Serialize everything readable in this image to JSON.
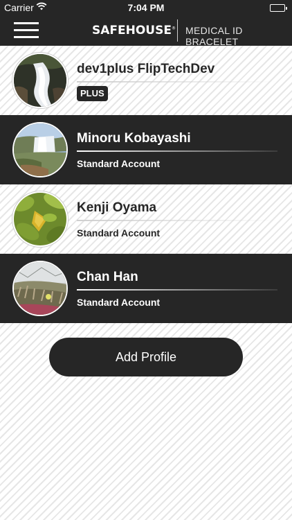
{
  "status_bar": {
    "carrier": "Carrier",
    "time": "7:04 PM"
  },
  "header": {
    "brand": "SAFEHOUSE",
    "brand_mark": "®",
    "subtitle": "MEDICAL ID BRACELET"
  },
  "profiles": [
    {
      "name": "dev1plus FlipTechDev",
      "badge": "PLUS",
      "theme": "light"
    },
    {
      "name": "Minoru Kobayashi",
      "account": "Standard Account",
      "theme": "dark"
    },
    {
      "name": "Kenji Oyama",
      "account": "Standard Account",
      "theme": "light"
    },
    {
      "name": "Chan Han",
      "account": "Standard Account",
      "theme": "dark"
    }
  ],
  "add_profile_label": "Add Profile",
  "colors": {
    "dark": "#262626",
    "light_bg": "#f4f4f4",
    "text_light": "#ffffff"
  }
}
